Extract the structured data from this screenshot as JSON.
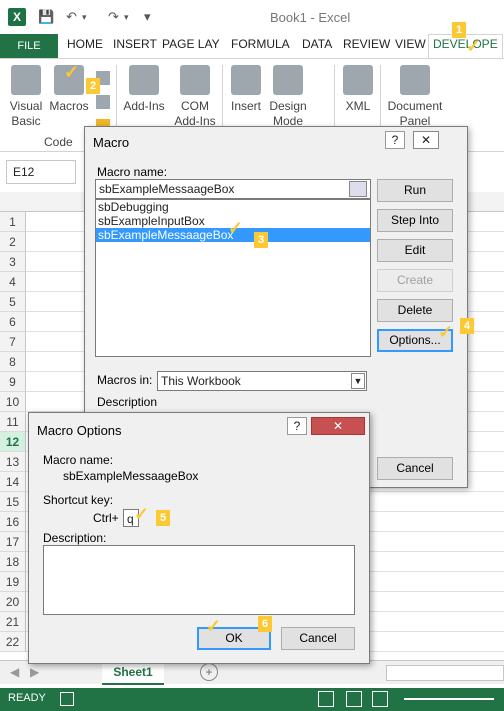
{
  "app": {
    "logo": "X",
    "title": "Book1 - Excel"
  },
  "qat": {
    "save_icon": "save-icon",
    "undo_icon": "undo-icon",
    "redo_icon": "redo-icon"
  },
  "tabs": [
    {
      "label": "FILE"
    },
    {
      "label": "HOME"
    },
    {
      "label": "INSERT"
    },
    {
      "label": "PAGE LAY"
    },
    {
      "label": "FORMULA"
    },
    {
      "label": "DATA"
    },
    {
      "label": "REVIEW"
    },
    {
      "label": "VIEW"
    },
    {
      "label": "DEVELOPE"
    }
  ],
  "ribbon": {
    "visual_basic": "Visual Basic",
    "macros": "Macros",
    "addins": "Add-Ins",
    "com_addins": "COM Add-Ins",
    "insert": "Insert",
    "design_mode": "Design Mode",
    "xml": "XML",
    "document_panel": "Document Panel",
    "group_code": "Code"
  },
  "namebox": "E12",
  "rows": [
    "1",
    "2",
    "3",
    "4",
    "5",
    "6",
    "7",
    "8",
    "9",
    "10",
    "11",
    "12",
    "13",
    "14",
    "15",
    "16",
    "17",
    "18",
    "19",
    "20",
    "21",
    "22"
  ],
  "sheet_tab": "Sheet1",
  "status": "READY",
  "macro_dialog": {
    "title": "Macro",
    "help": "?",
    "close": "✕",
    "name_label": "Macro name:",
    "name_value": "sbExampleMessaageBox",
    "list": [
      "sbDebugging",
      "sbExampleInputBox",
      "sbExampleMessaageBox"
    ],
    "selected_index": 2,
    "buttons": {
      "run": "Run",
      "step_into": "Step Into",
      "edit": "Edit",
      "create": "Create",
      "delete": "Delete",
      "options": "Options...",
      "cancel": "Cancel"
    },
    "macros_in_label": "Macros in:",
    "macros_in_value": "This Workbook",
    "description_label": "Description"
  },
  "options_dialog": {
    "title": "Macro Options",
    "help": "?",
    "close": "✕",
    "macro_name_label": "Macro name:",
    "macro_name_value": "sbExampleMessaageBox",
    "shortcut_label": "Shortcut key:",
    "ctrl_label": "Ctrl+",
    "shortcut_value": "q",
    "description_label": "Description:",
    "ok": "OK",
    "cancel": "Cancel"
  },
  "callouts": [
    "1",
    "2",
    "3",
    "4",
    "5",
    "6"
  ],
  "colors": {
    "excel_green": "#217346",
    "callout_yellow": "#fcc934",
    "selection_blue": "#3399ff"
  }
}
